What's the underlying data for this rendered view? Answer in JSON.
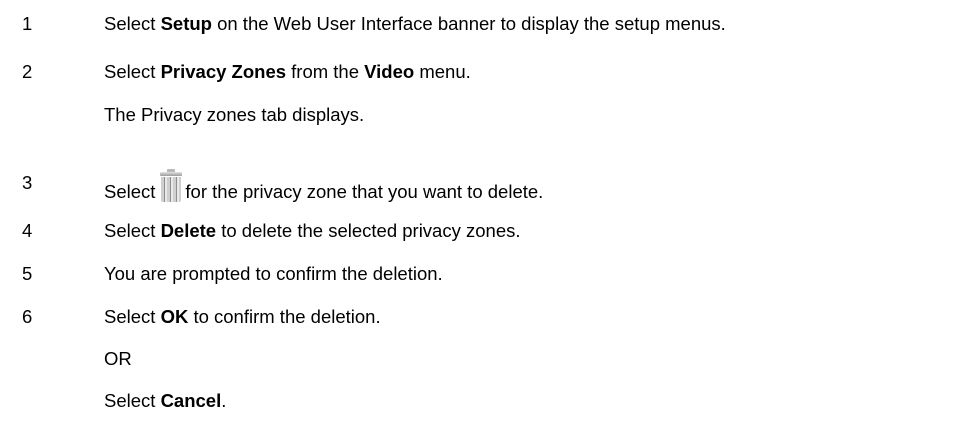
{
  "steps": [
    {
      "number": "1",
      "pre": "Select ",
      "bold": "Setup",
      "post": " on the Web User Interface banner to display the setup menus."
    },
    {
      "number": "2",
      "pre": "Select ",
      "bold1": "Privacy Zones",
      "mid": " from the ",
      "bold2": "Video",
      "post": " menu.",
      "result": "The Privacy zones tab displays."
    },
    {
      "number": "3",
      "pre": "Select",
      "icon": "trash-can-icon",
      "post": "for the privacy zone that you want to delete."
    },
    {
      "number": "4",
      "pre": "Select ",
      "bold": "Delete",
      "post": " to delete the selected privacy zones."
    },
    {
      "number": "5",
      "text": "You are prompted to confirm the deletion."
    },
    {
      "number": "6",
      "pre": "Select ",
      "bold": "OK",
      "post": " to confirm the deletion.",
      "or": "OR",
      "alt_pre": "Select ",
      "alt_bold": "Cancel",
      "alt_post": "."
    }
  ]
}
